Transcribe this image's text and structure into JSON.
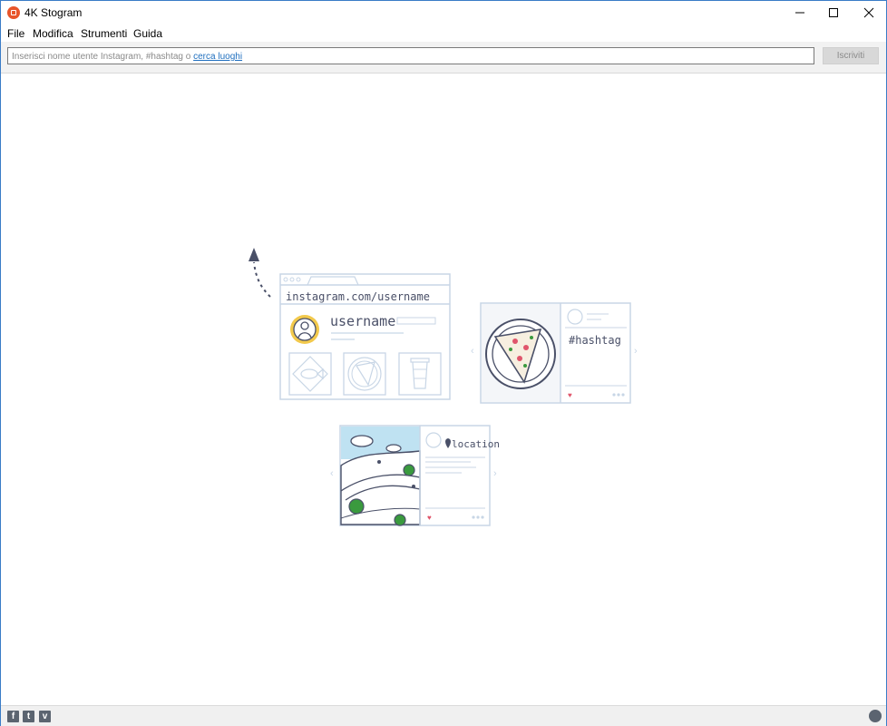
{
  "window": {
    "title": "4K Stogram",
    "icon": "app-logo-icon",
    "controls": [
      "minimize-icon",
      "maximize-icon",
      "close-icon"
    ]
  },
  "menu": {
    "items": [
      {
        "label": "File"
      },
      {
        "label": "Modifica"
      },
      {
        "label": "Strumenti"
      },
      {
        "label": "Guida"
      }
    ]
  },
  "search": {
    "placeholder_prefix": "Inserisci nome utente Instagram, #hashtag o ",
    "placeholder_link": "cerca luoghi",
    "subscribe_label": "Iscriviti"
  },
  "illustration": {
    "url_text": "instagram.com/username",
    "username_text": "username",
    "hashtag_text": "#hashtag",
    "location_text": "location"
  },
  "footer": {
    "social": [
      {
        "icon": "facebook-icon",
        "glyph": "f"
      },
      {
        "icon": "twitter-icon",
        "glyph": "t"
      },
      {
        "icon": "vimeo-icon",
        "glyph": "v"
      }
    ],
    "right_icon": "globe-icon"
  },
  "colors": {
    "accent_link": "#1f6fbf",
    "app_icon": "#e8552a",
    "illustration_outline": "#c8d6e6",
    "illustration_ink": "#4a5068",
    "avatar_yellow": "#f2c94c",
    "heart": "#e0556b",
    "sky": "#bfe2f2",
    "tree_green": "#3a9a3e"
  }
}
